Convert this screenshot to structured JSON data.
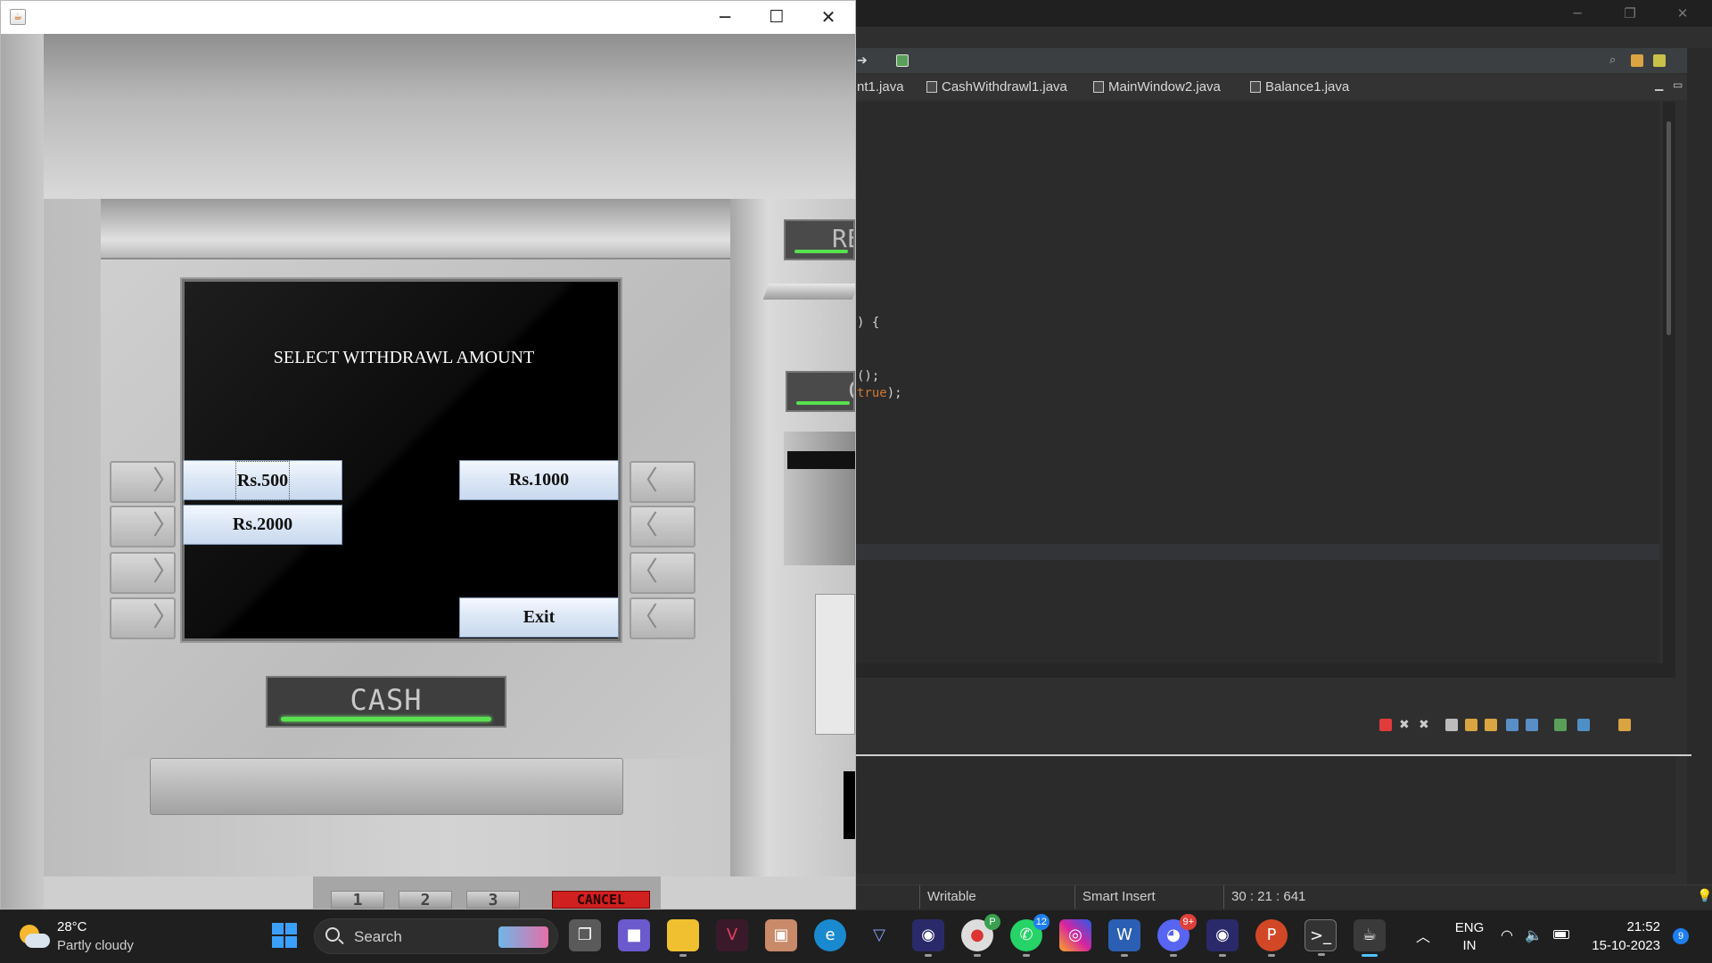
{
  "ide": {
    "tabs": [
      "nt1.java",
      "CashWithdrawl1.java",
      "MainWindow2.java",
      "Balance1.java"
    ],
    "code": {
      "line1": ") {",
      "line2": "();",
      "line3_kw": "true",
      "line3_rest": ");"
    },
    "status": {
      "mode": "Writable",
      "insert": "Smart Insert",
      "position": "30 : 21 : 641"
    }
  },
  "atm_window": {
    "caption_buttons": {
      "minimize": "─",
      "maximize": "☐",
      "close": "✕"
    },
    "screen_title": "SELECT WITHDRAWL AMOUNT",
    "buttons": {
      "rs500": "Rs.500",
      "rs1000": "Rs.1000",
      "rs2000": "Rs.2000",
      "exit": "Exit"
    },
    "cash_label": "CASH",
    "right_labels": {
      "top": "RE",
      "middle": "C"
    },
    "keypad": {
      "key1": "1",
      "key2": "2",
      "key3": "3",
      "cancel": "CANCEL"
    }
  },
  "taskbar": {
    "weather": {
      "temp": "28°C",
      "condition": "Partly cloudy"
    },
    "search_label": "Search",
    "language": {
      "line1": "ENG",
      "line2": "IN"
    },
    "time": "21:52",
    "date": "15-10-2023",
    "notification_count": "9",
    "badges": {
      "chrome": "P",
      "whatsapp": "12",
      "discord": "9+"
    },
    "colors": {
      "accent": "#1e7ff0",
      "taskbar_bg": "#1f1f1f"
    }
  }
}
